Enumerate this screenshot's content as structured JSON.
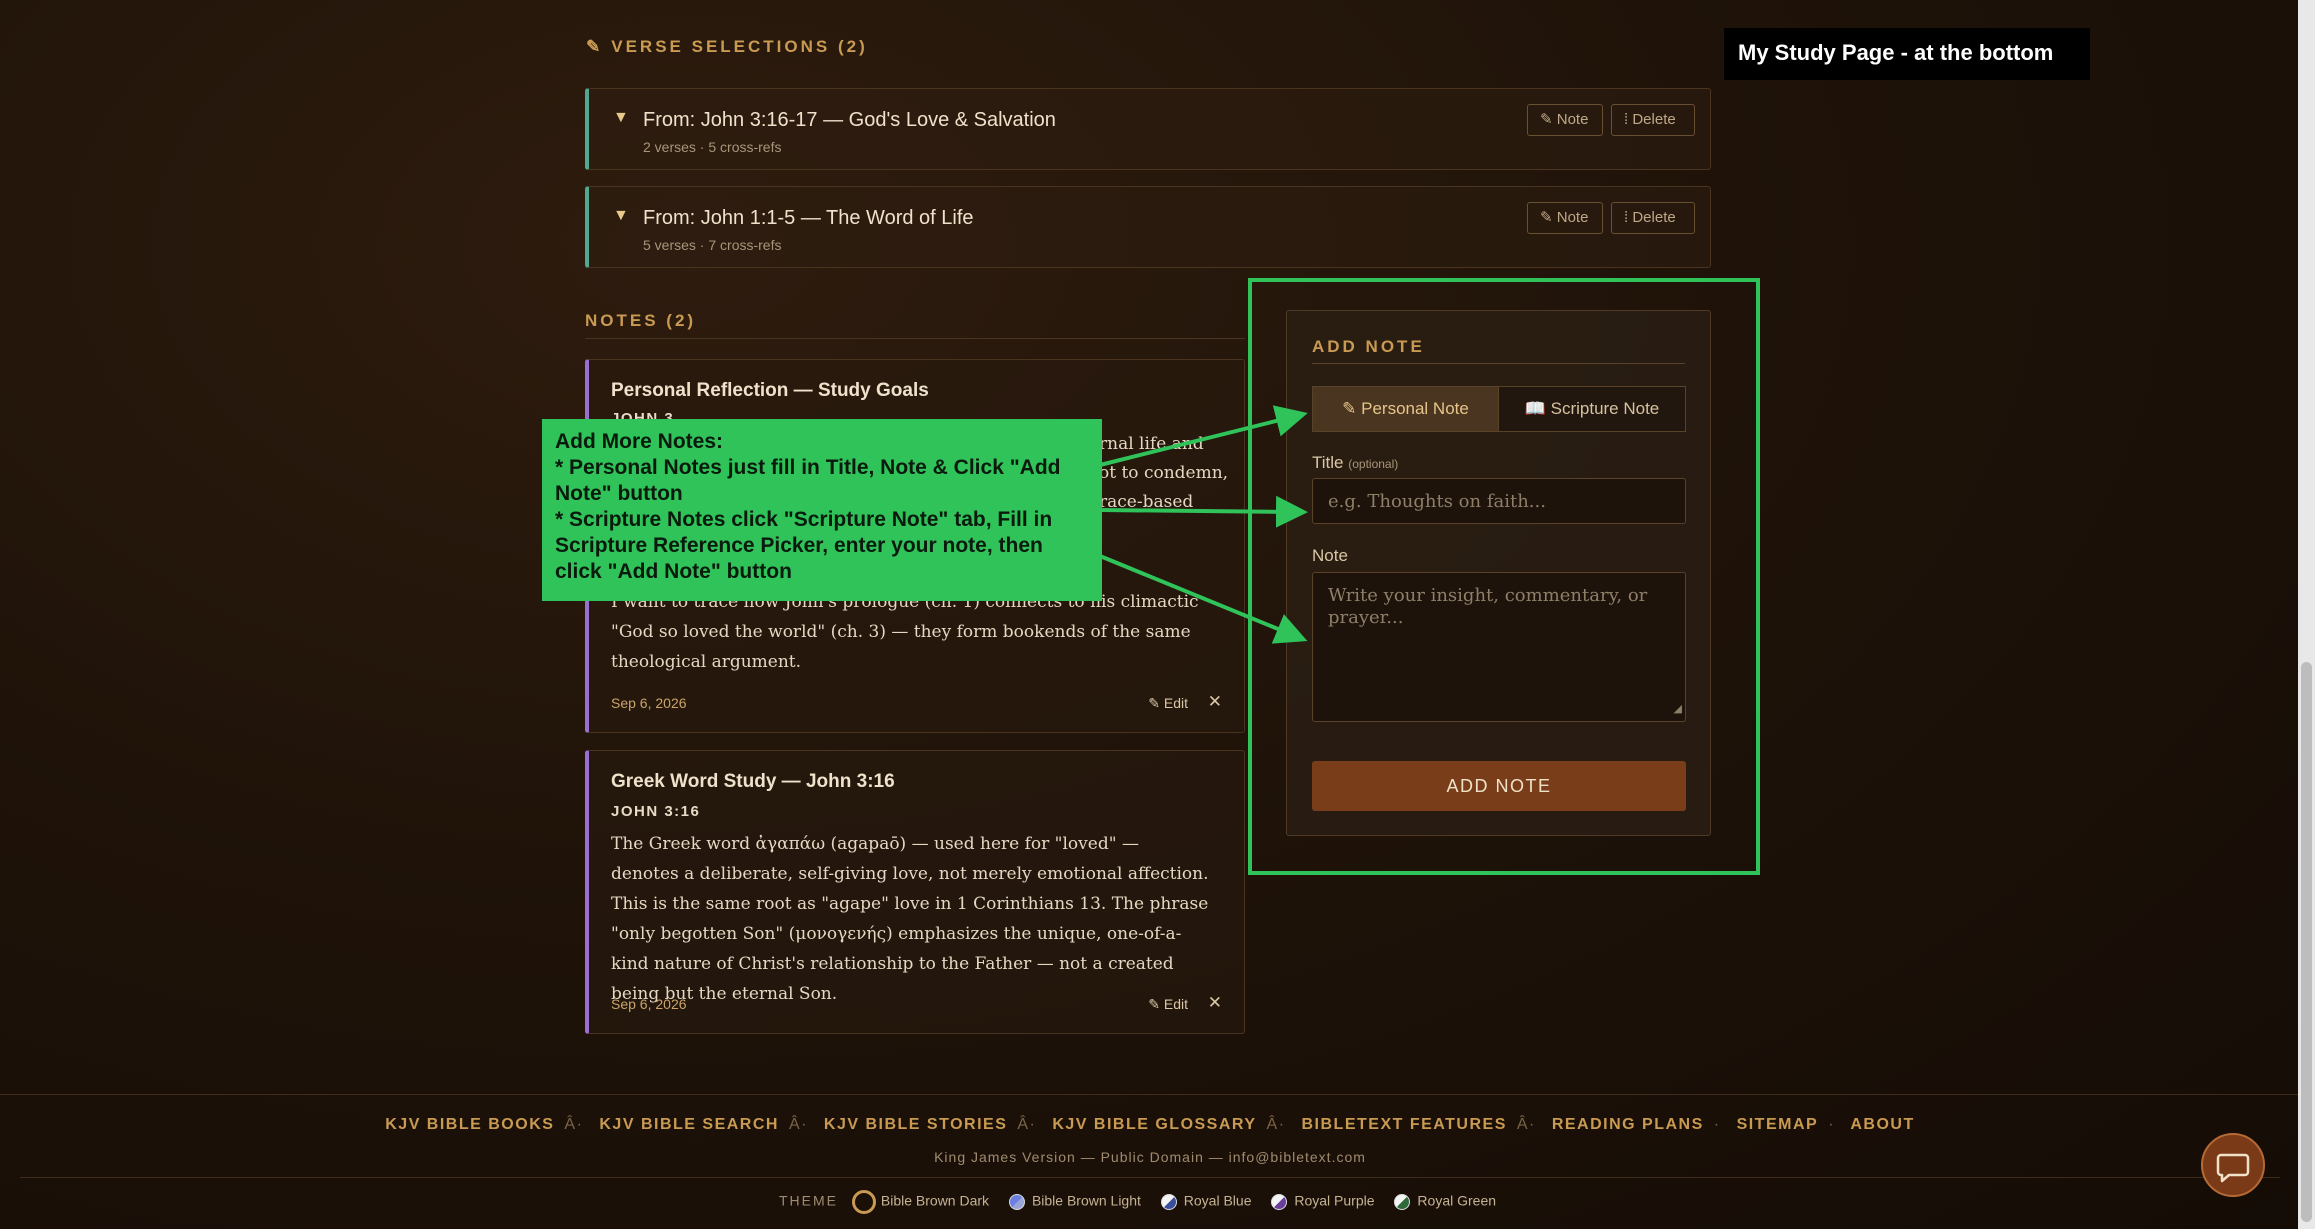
{
  "verse_selections": {
    "heading": "VERSE SELECTIONS (2)",
    "icon": "pencil-icon",
    "items": [
      {
        "title": "From: John 3:16-17 — God's Love & Salvation",
        "meta": "2 verses · 5 cross-refs",
        "note_label": "Note",
        "delete_label": "Delete"
      },
      {
        "title": "From: John 1:1-5 — The Word of Life",
        "meta": "5 verses · 7 cross-refs",
        "note_label": "Note",
        "delete_label": "Delete"
      }
    ]
  },
  "notes": {
    "heading": "NOTES (2)",
    "items": [
      {
        "title": "Personal Reflection — Study Goals",
        "ref": "JOHN 3",
        "body_partial": [
          "rnal life and",
          "ot to condemn,",
          "race-based"
        ],
        "body_visible": "I want to trace how John's prologue (ch. 1) connects to his climactic \"God so loved the world\" (ch. 3) — they form bookends of the same theological argument.",
        "date": "Sep 6, 2026",
        "edit_label": "Edit"
      },
      {
        "title": "Greek Word Study — John 3:16",
        "ref": "JOHN 3:16",
        "body": "The Greek word ἀγαπάω (agapaō) — used here for \"loved\" — denotes a deliberate, self-giving love, not merely emotional affection. This is the same root as \"agape\" love in 1 Corinthians 13. The phrase \"only begotten Son\" (μονογενής) emphasizes the unique, one-of-a-kind nature of Christ's relationship to the Father — not a created being but the eternal Son.",
        "date": "Sep 6, 2026",
        "edit_label": "Edit"
      }
    ]
  },
  "add_note": {
    "heading": "ADD NOTE",
    "tabs": [
      {
        "label": "Personal Note",
        "icon": "pencil-icon",
        "active": true
      },
      {
        "label": "Scripture Note",
        "icon": "book-icon",
        "active": false
      }
    ],
    "title_label": "Title",
    "title_optional": "(optional)",
    "title_placeholder": "e.g. Thoughts on faith...",
    "note_label": "Note",
    "note_placeholder": "Write your insight, commentary, or prayer...",
    "submit_label": "ADD NOTE"
  },
  "annotations": {
    "callout_lines": [
      "Add More Notes:",
      "* Personal Notes just fill in Title,  Note & Click \"Add Note\" button",
      "* Scripture Notes click \"Scripture Note\" tab, Fill in Scripture Reference Picker, enter your note, then click \"Add Note\" button"
    ],
    "corner_label": "My Study Page - at the bottom",
    "highlight_color": "#2fc35a"
  },
  "footer": {
    "links": [
      "KJV BIBLE BOOKS",
      "KJV BIBLE SEARCH",
      "KJV BIBLE STORIES",
      "KJV BIBLE GLOSSARY",
      "BIBLETEXT FEATURES",
      "READING PLANS",
      "SITEMAP",
      "ABOUT"
    ],
    "separators": [
      "Â·",
      "Â·",
      "Â·",
      "Â·",
      "Â·",
      "·",
      "·"
    ],
    "copyright": "King James Version — Public Domain — ",
    "email": "info@bibletext.com",
    "theme_label": "THEME",
    "themes": [
      {
        "name": "Bible Brown Dark",
        "color": "#1a1008"
      },
      {
        "name": "Bible Brown Light",
        "color": "#6a7fe0"
      },
      {
        "name": "Royal Blue",
        "color": "#3a4f9c"
      },
      {
        "name": "Royal Purple",
        "color": "#6a3f9c"
      },
      {
        "name": "Royal Green",
        "color": "#2f6a3a"
      }
    ]
  },
  "colors": {
    "accent": "#c99a52",
    "verse_border": "#4fa88f",
    "note_border": "#9b6fd0",
    "button": "#7a3d1a"
  }
}
